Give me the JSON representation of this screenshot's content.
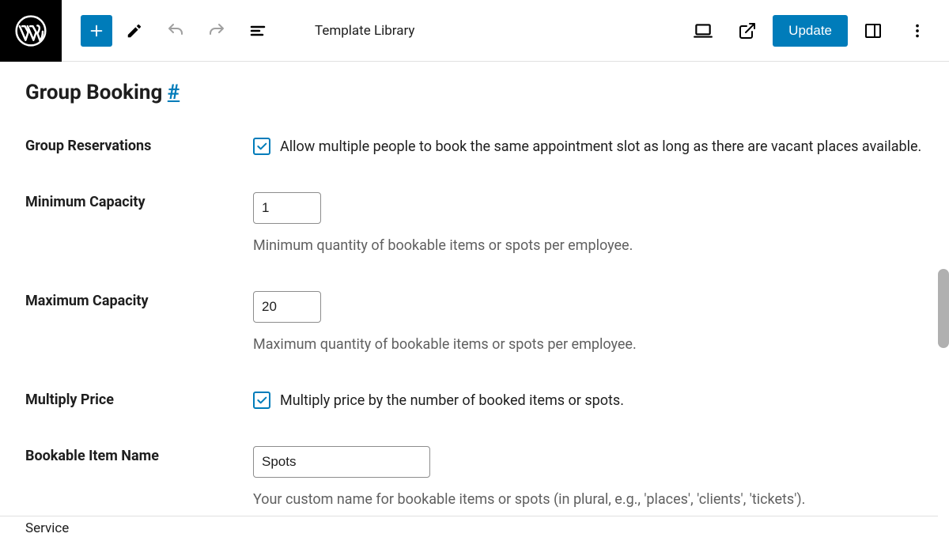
{
  "header": {
    "page_title": "Template Library",
    "update_label": "Update"
  },
  "section": {
    "title": "Group Booking",
    "anchor": "#"
  },
  "fields": {
    "group_reservations": {
      "label": "Group Reservations",
      "checkbox_text": "Allow multiple people to book the same appointment slot as long as there are vacant places available."
    },
    "minimum_capacity": {
      "label": "Minimum Capacity",
      "value": "1",
      "description": "Minimum quantity of bookable items or spots per employee."
    },
    "maximum_capacity": {
      "label": "Maximum Capacity",
      "value": "20",
      "description": "Maximum quantity of bookable items or spots per employee."
    },
    "multiply_price": {
      "label": "Multiply Price",
      "checkbox_text": "Multiply price by the number of booked items or spots."
    },
    "bookable_item_name": {
      "label": "Bookable Item Name",
      "value": "Spots",
      "description": "Your custom name for bookable items or spots (in plural, e.g., 'places', 'clients', 'tickets')."
    }
  },
  "footer": {
    "label": "Service"
  }
}
